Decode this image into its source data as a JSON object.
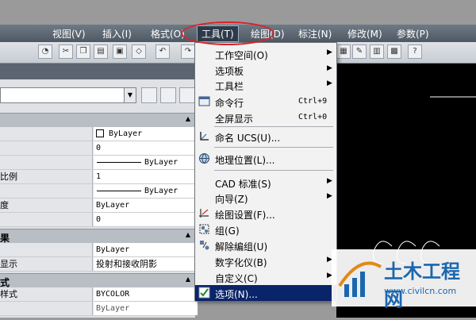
{
  "menubar": {
    "items": [
      {
        "label": "视图(V)"
      },
      {
        "label": "插入(I)"
      },
      {
        "label": "格式(O)"
      },
      {
        "label": "工具(T)"
      },
      {
        "label": "绘图(D)"
      },
      {
        "label": "标注(N)"
      },
      {
        "label": "修改(M)"
      },
      {
        "label": "参数(P)"
      }
    ]
  },
  "tools_menu": {
    "items": [
      {
        "label": "工作空间(O)",
        "submenu": "▶"
      },
      {
        "label": "选项板",
        "submenu": "▶"
      },
      {
        "label": "工具栏",
        "submenu": "▶"
      },
      {
        "label": "命令行",
        "shortcut": "Ctrl+9"
      },
      {
        "label": "全屏显示",
        "shortcut": "Ctrl+0"
      },
      {
        "label": "命名 UCS(U)..."
      },
      {
        "label": "地理位置(L)..."
      },
      {
        "label": "CAD 标准(S)",
        "submenu": "▶"
      },
      {
        "label": "向导(Z)",
        "submenu": "▶"
      },
      {
        "label": "绘图设置(F)..."
      },
      {
        "label": "组(G)"
      },
      {
        "label": "解除编组(U)"
      },
      {
        "label": "数字化仪(B)",
        "submenu": "▶"
      },
      {
        "label": "自定义(C)",
        "submenu": "▶"
      },
      {
        "label": "选项(N)..."
      }
    ],
    "selected_item": "选项(N)..."
  },
  "properties": {
    "sections": [
      {
        "label": ""
      },
      {
        "label": "果"
      },
      {
        "label": "式"
      }
    ],
    "rows": [
      {
        "key": "",
        "value": "ByLayer"
      },
      {
        "key": "",
        "value": "0"
      },
      {
        "key": "",
        "value": "ByLayer"
      },
      {
        "key": "比例",
        "value": "1"
      },
      {
        "key": "",
        "value": "ByLayer"
      },
      {
        "key": "度",
        "value": "ByLayer"
      },
      {
        "key": "",
        "value": "0"
      },
      {
        "key": "",
        "value": "ByLayer"
      },
      {
        "key": "显示",
        "value": "投射和接收阴影"
      },
      {
        "key": "样式",
        "value": "BYCOLOR"
      },
      {
        "key": "",
        "value": "ByLayer"
      }
    ]
  },
  "watermark": {
    "title": "土木工程网",
    "url": "www.civilcn.com"
  },
  "colors": {
    "highlight_circle": "#e0202a",
    "menu_selection": "#0a246a",
    "watermark_blue": "#1a67b0"
  }
}
